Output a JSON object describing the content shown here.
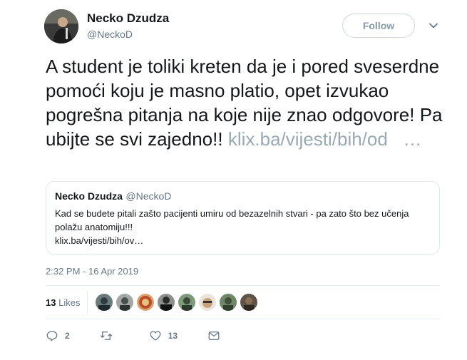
{
  "author": {
    "name": "Necko Dzudza",
    "handle": "@NeckoD",
    "follow_label": "Follow"
  },
  "tweet": {
    "text": "A student je toliki kreten da je i pored sveserdne pomoći koju je masno platio, opet izvukao pogrešna pitanja na koje nije znao odgovore! Pa ubijte se svi zajedno!!",
    "link": "klix.ba/vijesti/bih/od",
    "link_ellipsis": "…"
  },
  "quote": {
    "name": "Necko Dzudza",
    "handle": "@NeckoD",
    "text": "Kad se budete pitali zašto pacijenti umiru od bezazelnih stvari - pa zato što bez učenja polažu anatomiju!!!",
    "link": "klix.ba/vijesti/bih/ov…"
  },
  "timestamp": "2:32 PM - 16 Apr 2019",
  "likes": {
    "count": "13",
    "label": "Likes"
  },
  "actions": {
    "replies": "2",
    "retweets": "",
    "likes": "13"
  },
  "colors": {
    "link": "#9aaab5",
    "secondary": "#657786",
    "border": "#e1e8ed"
  }
}
